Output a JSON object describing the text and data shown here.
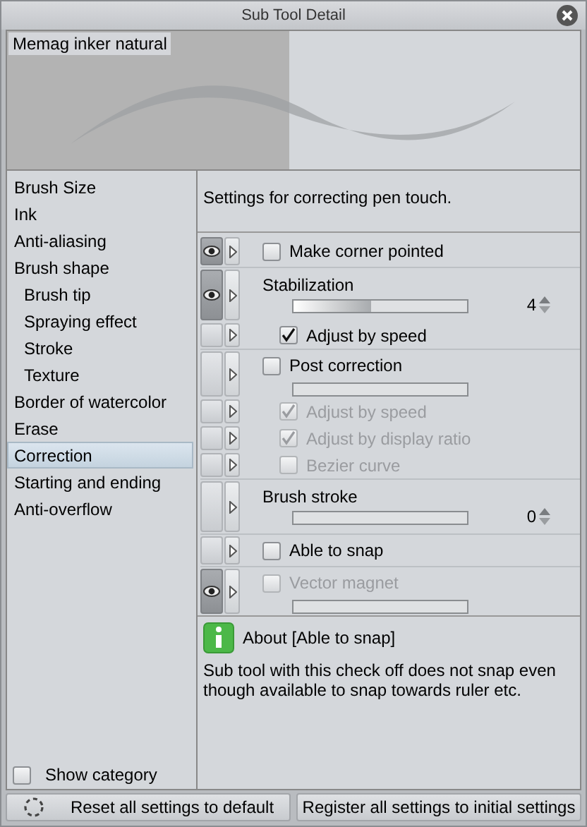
{
  "window": {
    "title": "Sub Tool Detail"
  },
  "preview": {
    "name": "Memag inker natural"
  },
  "categories": [
    {
      "label": "Brush Size",
      "selected": false
    },
    {
      "label": "Ink",
      "selected": false
    },
    {
      "label": "Anti-aliasing",
      "selected": false
    },
    {
      "label": "Brush shape",
      "selected": false,
      "children": [
        {
          "label": "Brush tip",
          "selected": false
        },
        {
          "label": "Spraying effect",
          "selected": false
        },
        {
          "label": "Stroke",
          "selected": false
        },
        {
          "label": "Texture",
          "selected": false
        }
      ]
    },
    {
      "label": "Border of watercolor",
      "selected": false
    },
    {
      "label": "Erase",
      "selected": false
    },
    {
      "label": "Correction",
      "selected": true
    },
    {
      "label": "Starting and ending",
      "selected": false
    },
    {
      "label": "Anti-overflow",
      "selected": false
    }
  ],
  "show_category": {
    "label": "Show category",
    "checked": false
  },
  "description": "Settings for correcting pen touch.",
  "settings": [
    {
      "kind": "checkbox",
      "label": "Make corner pointed",
      "visible": true,
      "checked": false,
      "disabled": false
    },
    {
      "kind": "slider",
      "label": "Stabilization",
      "visible": true,
      "level": 0.45,
      "value": "4",
      "children": [
        {
          "label": "Adjust by speed",
          "visible": false,
          "checked": true,
          "disabled": false
        }
      ]
    },
    {
      "kind": "checkbox-slider",
      "label": "Post correction",
      "visible": false,
      "checked": false,
      "disabled": false,
      "children": [
        {
          "label": "Adjust by speed",
          "visible": false,
          "checked": true,
          "disabled": true
        },
        {
          "label": "Adjust by display ratio",
          "visible": false,
          "checked": true,
          "disabled": true
        },
        {
          "label": "Bezier curve",
          "visible": false,
          "checked": false,
          "disabled": true
        }
      ]
    },
    {
      "kind": "slider",
      "label": "Brush stroke",
      "visible": false,
      "value": "0"
    },
    {
      "kind": "checkbox",
      "label": "Able to snap",
      "visible": false,
      "checked": false,
      "disabled": false
    },
    {
      "kind": "checkbox-slider",
      "label": "Vector magnet",
      "visible": true,
      "checked": false,
      "disabled": true
    }
  ],
  "help": {
    "title": "About [Able to snap]",
    "text": "Sub tool with this check off does not snap even though available to snap towards ruler etc."
  },
  "buttons": [
    {
      "kind": "reset",
      "label": "Reset all settings to default"
    },
    {
      "kind": "register",
      "label": "Register all settings to initial settings"
    }
  ]
}
